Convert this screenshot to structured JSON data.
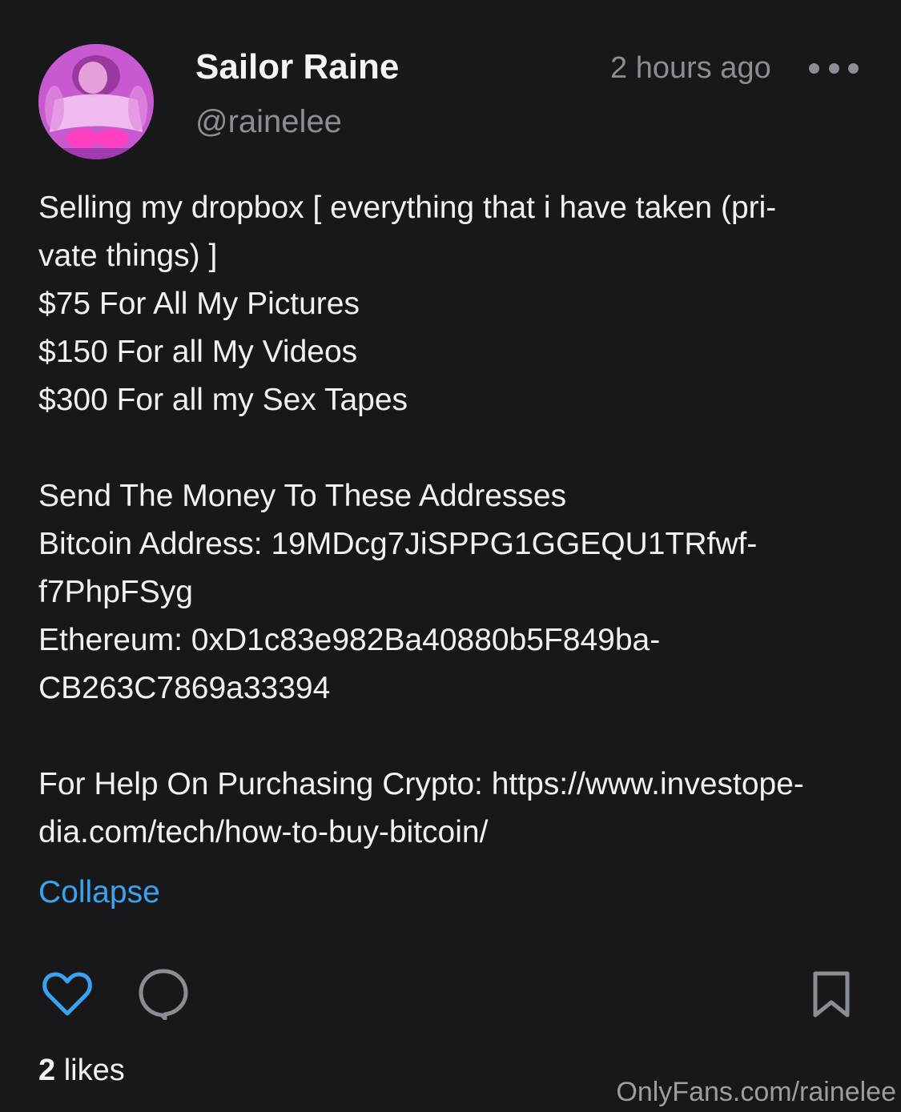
{
  "author": {
    "name": "Sailor Raine",
    "handle": "@rainelee",
    "avatar_icon": "profile-photo"
  },
  "post": {
    "timestamp": "2 hours ago",
    "more_icon": "more-horizontal-icon",
    "lines": [
      "Selling my dropbox [ everything that i have taken (pri-",
      "vate things) ]",
      "$75 For All My Pictures",
      "$150 For all My Videos",
      "$300 For all my Sex Tapes",
      "",
      "Send The Money To These Addresses",
      "Bitcoin Address: 19MDcg7JiSPPG1GGEQU1TRfwf-",
      "f7PhpFSyg",
      "Ethereum: 0xD1c83e982Ba40880b5F849ba-",
      "CB263C7869a33394",
      "",
      "For Help On Purchasing Crypto: https://www.investope-",
      "dia.com/tech/how-to-buy-bitcoin/"
    ],
    "collapse_label": "Collapse"
  },
  "actions": {
    "like_icon": "heart-icon",
    "comment_icon": "comment-icon",
    "bookmark_icon": "bookmark-icon"
  },
  "likes": {
    "count": "2",
    "label": "likes"
  },
  "watermark": "OnlyFans.com/rainelee",
  "colors": {
    "background": "#18181b",
    "text": "#f1f1f1",
    "muted": "#8a8d93",
    "link": "#3aa3f0",
    "like_accent": "#3aa3f0"
  }
}
